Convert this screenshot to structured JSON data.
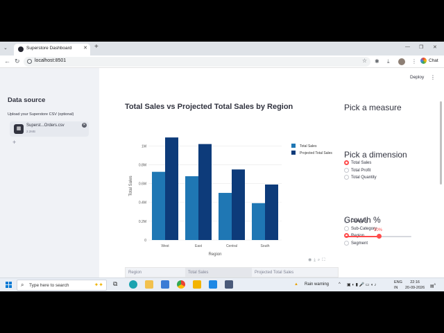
{
  "browser": {
    "tab_title": "Superstore Dashboard",
    "url": "localhost:8501",
    "chat_label": "Chat"
  },
  "sidebar": {
    "title": "Data source",
    "upload_label": "Upload your Superstore CSV (optional)",
    "file": {
      "name": "Superst...Orders.csv",
      "size": "2.2MB"
    }
  },
  "header": {
    "deploy_label": "Deploy"
  },
  "chart_title": "Total Sales vs Projected Total Sales by Region",
  "chart_data": {
    "type": "bar",
    "categories": [
      "West",
      "East",
      "Central",
      "South"
    ],
    "series": [
      {
        "name": "Total Sales",
        "values": [
          725000,
          678000,
          501000,
          392000
        ],
        "color": "#1f77b4"
      },
      {
        "name": "Projected Total Sales",
        "values": [
          1090000,
          1020000,
          750000,
          590000
        ],
        "color": "#0d3b7a"
      }
    ],
    "ytick_labels": [
      "0",
      "0.2M",
      "0.4M",
      "0.6M",
      "0.8M",
      "1M"
    ],
    "yticks": [
      0,
      200000,
      400000,
      600000,
      800000,
      1000000
    ],
    "ylim": [
      0,
      1150000
    ],
    "xlabel": "Region",
    "ylabel": "Total Sales",
    "legend_position": "top-right",
    "grid": true
  },
  "measure": {
    "heading": "Pick a measure",
    "options": [
      "Total Sales",
      "Total Profit",
      "Total Quantity"
    ],
    "selected": 0
  },
  "dimension": {
    "heading": "Pick a dimension",
    "options": [
      "Category",
      "Sub-Category",
      "Region",
      "Segment"
    ],
    "selected": 2
  },
  "growth": {
    "heading": "Growth %",
    "value_label": "50%",
    "value": 0.5
  },
  "table": {
    "headers": [
      "Region",
      "Total Sales",
      "Projected Total Sales"
    ]
  },
  "taskbar": {
    "search_placeholder": "Type here to search",
    "weather": "Rain warning",
    "lang_top": "ENG",
    "lang_bottom": "IN",
    "time": "22:16",
    "date": "20-09-2026",
    "notification_count": "5"
  },
  "icons": {
    "tab_menu": "tab-list-icon",
    "close": "close-icon",
    "new_tab": "plus-icon",
    "back": "back-icon",
    "refresh": "refresh-icon",
    "star": "star-icon",
    "extensions": "puzzle-icon",
    "download": "download-icon",
    "table": "table-icon",
    "settings": "kebab-icon"
  },
  "colors": {
    "accent": "#ff4b4b",
    "sidebar_bg": "#f0f2f6",
    "bar1": "#1f77b4",
    "bar2": "#0d3b7a"
  }
}
